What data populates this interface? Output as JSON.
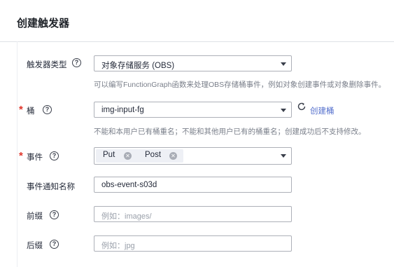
{
  "page": {
    "title": "创建触发器"
  },
  "form": {
    "trigger_type": {
      "label": "触发器类型",
      "value": "对象存储服务 (OBS)",
      "hint": "可以编写FunctionGraph函数来处理OBS存储桶事件，例如对象创建事件或对象删除事件。"
    },
    "bucket": {
      "label": "桶",
      "value": "img-input-fg",
      "create_label": "创建桶",
      "hint": "不能和本用户已有桶重名；不能和其他用户已有的桶重名；创建成功后不支持修改。"
    },
    "event": {
      "label": "事件",
      "tags": [
        "Put",
        "Post"
      ]
    },
    "event_name": {
      "label": "事件通知名称",
      "value": "obs-event-s03d"
    },
    "prefix": {
      "label": "前缀",
      "placeholder": "例如：images/"
    },
    "suffix": {
      "label": "后缀",
      "placeholder": "例如：jpg"
    }
  },
  "icons": {
    "help": "help-circle-icon",
    "refresh": "refresh-icon",
    "caret": "chevron-down-icon",
    "tag_remove": "close-circle-icon"
  },
  "colors": {
    "required": "#e0362b",
    "link": "#526ecc",
    "border": "#adb0b8",
    "tag_bg": "#eef0f5"
  }
}
